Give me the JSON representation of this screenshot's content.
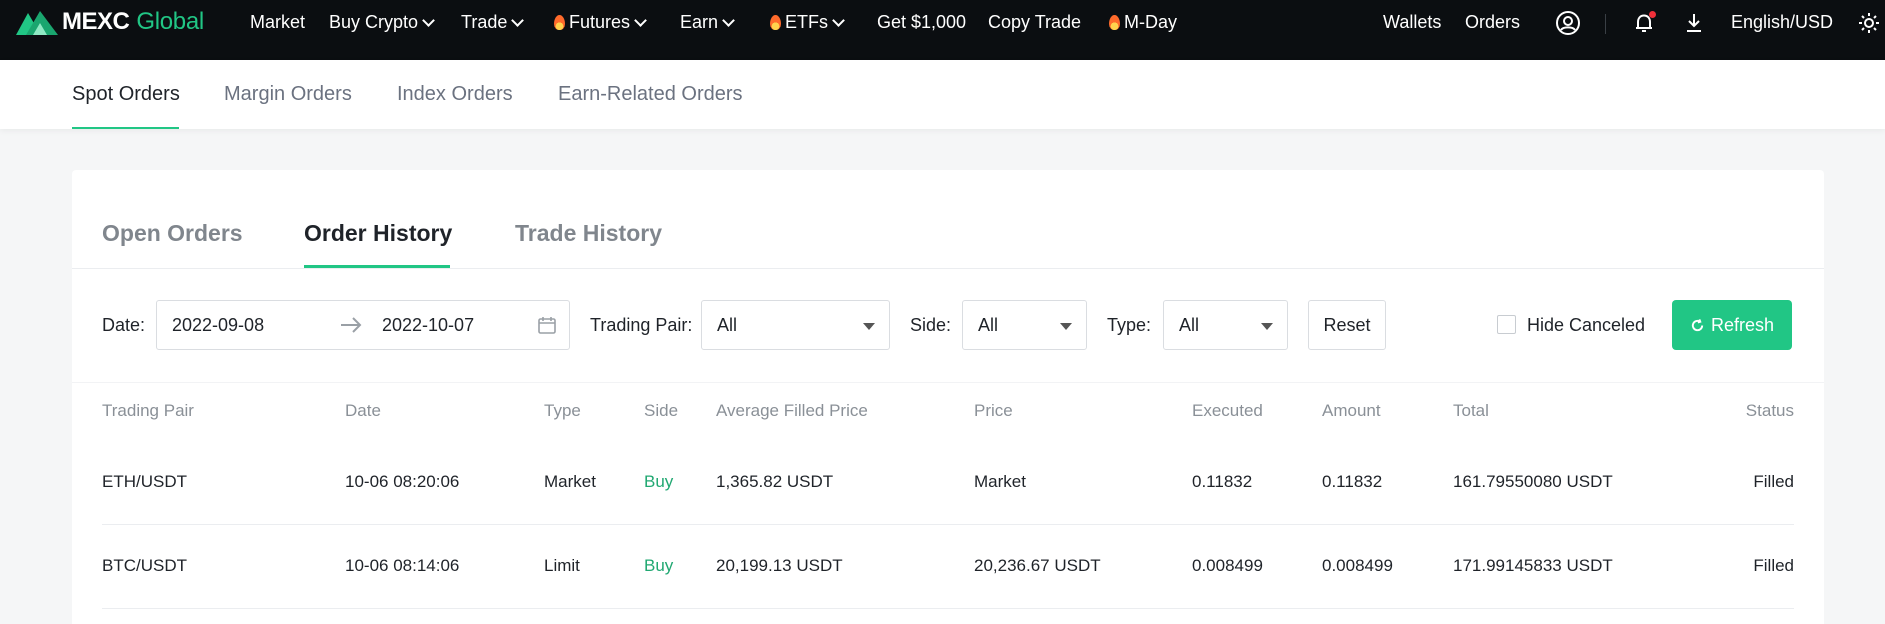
{
  "nav": {
    "logo_main": "MEXC",
    "logo_sub": "Global",
    "items": [
      {
        "label": "Market"
      },
      {
        "label": "Buy Crypto"
      },
      {
        "label": "Trade"
      },
      {
        "label": "Futures"
      },
      {
        "label": "Earn"
      },
      {
        "label": "ETFs"
      },
      {
        "label": "Get $1,000"
      },
      {
        "label": "Copy Trade"
      },
      {
        "label": "M-Day"
      }
    ],
    "wallets": "Wallets",
    "orders": "Orders",
    "language": "English/USD"
  },
  "subnav": {
    "tabs": [
      "Spot Orders",
      "Margin Orders",
      "Index Orders",
      "Earn-Related Orders"
    ],
    "active": "Spot Orders"
  },
  "history_tabs": {
    "tabs": [
      "Open Orders",
      "Order History",
      "Trade History"
    ],
    "active": "Order History"
  },
  "filters": {
    "date_label": "Date",
    "date_from": "2022-09-08",
    "date_to": "2022-10-07",
    "pair_label": "Trading Pair",
    "pair_value": "All",
    "side_label": "Side",
    "side_value": "All",
    "type_label": "Type",
    "type_value": "All",
    "reset": "Reset",
    "hide_canceled": "Hide Canceled",
    "refresh": "Refresh"
  },
  "table": {
    "headers": [
      "Trading Pair",
      "Date",
      "Type",
      "Side",
      "Average Filled Price",
      "Price",
      "Executed",
      "Amount",
      "Total",
      "Status"
    ],
    "rows": [
      [
        "ETH/USDT",
        "10-06 08:20:06",
        "Market",
        "Buy",
        "1,365.82 USDT",
        "Market",
        "0.11832",
        "0.11832",
        "161.79550080 USDT",
        "Filled"
      ],
      [
        "BTC/USDT",
        "10-06 08:14:06",
        "Limit",
        "Buy",
        "20,199.13 USDT",
        "20,236.67 USDT",
        "0.008499",
        "0.008499",
        "171.99145833 USDT",
        "Filled"
      ]
    ]
  },
  "colors": {
    "accent": "#21c685",
    "buy": "#21a872",
    "nav_bg": "#0b0e11"
  }
}
